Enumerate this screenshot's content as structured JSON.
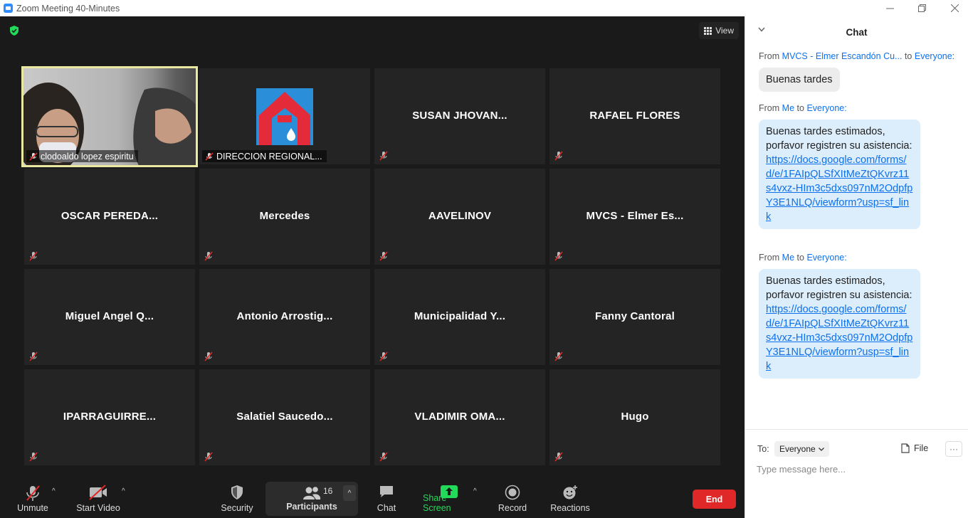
{
  "window": {
    "title": "Zoom Meeting 40-Minutes"
  },
  "meeting": {
    "view_label": "View",
    "tiles": [
      {
        "name": "clodoaldo lopez espiritu",
        "kind": "video"
      },
      {
        "name": "DIRECCION REGIONAL...",
        "kind": "logo"
      },
      {
        "name": "SUSAN  JHOVAN..."
      },
      {
        "name": "RAFAEL FLORES"
      },
      {
        "name": "OSCAR  PEREDA..."
      },
      {
        "name": "Mercedes"
      },
      {
        "name": "AAVELINOV"
      },
      {
        "name": "MVCS - Elmer Es..."
      },
      {
        "name": "Miguel Angel Q..."
      },
      {
        "name": "Antonio  Arrostig..."
      },
      {
        "name": "Municipalidad  Y..."
      },
      {
        "name": "Fanny Cantoral"
      },
      {
        "name": "IPARRAGUIRRE..."
      },
      {
        "name": "Salatiel  Saucedo..."
      },
      {
        "name": "VLADIMIR  OMA..."
      },
      {
        "name": "Hugo"
      }
    ]
  },
  "toolbar": {
    "unmute": "Unmute",
    "start_video": "Start Video",
    "security": "Security",
    "participants": "Participants",
    "participants_count": "16",
    "chat": "Chat",
    "share_screen": "Share Screen",
    "record": "Record",
    "reactions": "Reactions",
    "end": "End",
    "share_color": "#23d959",
    "end_color": "#e02828"
  },
  "chat": {
    "title": "Chat",
    "messages": [
      {
        "from_prefix": "From",
        "from": "MVCS - Elmer Escandón Cu...",
        "to_prefix": "to",
        "to": "Everyone:",
        "text": "Buenas tardes",
        "link": ""
      },
      {
        "from_prefix": "From",
        "from": "Me",
        "to_prefix": "to",
        "to": "Everyone:",
        "text": "Buenas tardes estimados, porfavor registren su asistencia:",
        "link": "https://docs.google.com/forms/d/e/1FAIpQLSfXItMeZtQKvrz11s4vxz-HIm3c5dxs097nM2OdpfpY3E1NLQ/viewform?usp=sf_link"
      },
      {
        "from_prefix": "From",
        "from": "Me",
        "to_prefix": "to",
        "to": "Everyone:",
        "text": "Buenas tardes estimados, porfavor registren su asistencia:",
        "link": "https://docs.google.com/forms/d/e/1FAIpQLSfXItMeZtQKvrz11s4vxz-HIm3c5dxs097nM2OdpfpY3E1NLQ/viewform?usp=sf_link"
      }
    ],
    "to_label": "To:",
    "recipient": "Everyone",
    "file_label": "File",
    "more_label": "···",
    "input_placeholder": "Type message here...",
    "link_color": "#0e71eb"
  }
}
